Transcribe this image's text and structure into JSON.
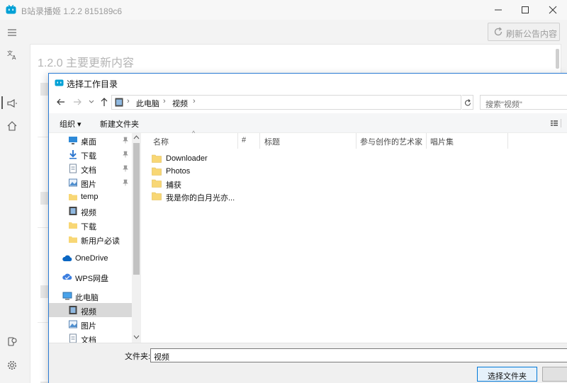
{
  "app": {
    "title": "B站录播姬 1.2.2 815189c6",
    "refresh_label": "刷新公告内容"
  },
  "notice": {
    "headings": [
      "1.2.0 主要更新内容"
    ]
  },
  "dialog": {
    "title": "选择工作目录",
    "breadcrumb": [
      "此电脑",
      "视频"
    ],
    "search_placeholder": "搜索\"视频\"",
    "toolbar": {
      "organize": "组织",
      "new_folder": "新建文件夹"
    },
    "nav_items": [
      {
        "label": "桌面",
        "icon": "desktop-icon",
        "pinned": true
      },
      {
        "label": "下载",
        "icon": "download-icon",
        "pinned": true
      },
      {
        "label": "文档",
        "icon": "document-icon",
        "pinned": true
      },
      {
        "label": "图片",
        "icon": "picture-icon",
        "pinned": true
      },
      {
        "label": "temp",
        "icon": "folder-icon",
        "pinned": false
      },
      {
        "label": "视频",
        "icon": "video-icon",
        "pinned": false
      },
      {
        "label": "下载",
        "icon": "folder-icon",
        "pinned": false
      },
      {
        "label": "新用户必读",
        "icon": "folder-icon",
        "pinned": false
      },
      {
        "label": "OneDrive",
        "icon": "cloud-icon",
        "pinned": false
      },
      {
        "label": "WPS网盘",
        "icon": "wps-cloud-icon",
        "pinned": false
      },
      {
        "label": "此电脑",
        "icon": "computer-icon",
        "pinned": false
      },
      {
        "label": "视频",
        "icon": "video-icon",
        "pinned": false,
        "selected": true
      },
      {
        "label": "图片",
        "icon": "picture-icon",
        "pinned": false
      },
      {
        "label": "文档",
        "icon": "document-icon",
        "pinned": false
      }
    ],
    "columns": [
      "名称",
      "#",
      "标题",
      "参与创作的艺术家",
      "唱片集"
    ],
    "files": [
      "Downloader",
      "Photos",
      "捕获",
      "我是你的白月光亦..."
    ],
    "folder_label": "文件夹:",
    "folder_value": "视频",
    "select_button": "选择文件夹"
  },
  "colors": {
    "accent": "#0078d7",
    "folder": "#f8d775"
  }
}
